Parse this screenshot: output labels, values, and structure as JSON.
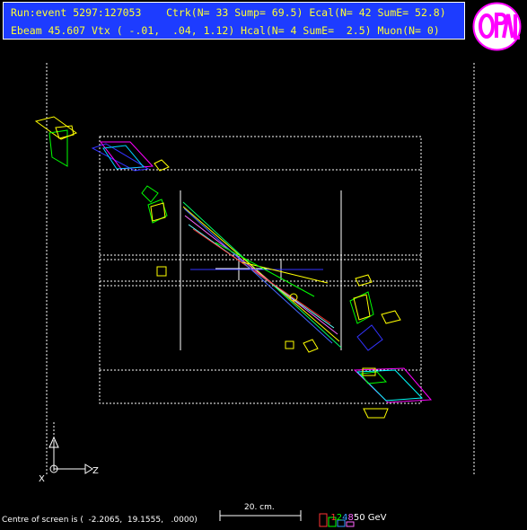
{
  "header": {
    "line1": "Run:event 5297:127053    Ctrk(N= 33 Sump= 69.5) Ecal(N= 42 SumE= 52.8)",
    "line2": "Ebeam 45.607 Vtx ( -.01,  .04, 1.12) Hcal(N= 4 SumE=  2.5) Muon(N= 0)"
  },
  "logo": {
    "text": "OPAL",
    "colors": {
      "ring": "#ff00ff",
      "fill": "#ffffff"
    }
  },
  "footer": {
    "centre_text": "Centre of screen is (  -2.2065,  19.1555,   .0000)",
    "scale_label": "20. cm.",
    "energy_scale": {
      "values": [
        "1",
        "2",
        "4",
        "8",
        "50 GeV"
      ],
      "colors": [
        "#ff3333",
        "#00ff00",
        "#3399ff",
        "#ff66ff",
        "#ffffff"
      ]
    }
  },
  "axes": {
    "x_label": "X",
    "z_label": "Z"
  },
  "colors": {
    "header_bg": "#1d3cff",
    "header_text": "#ffff33",
    "background": "#000000"
  }
}
